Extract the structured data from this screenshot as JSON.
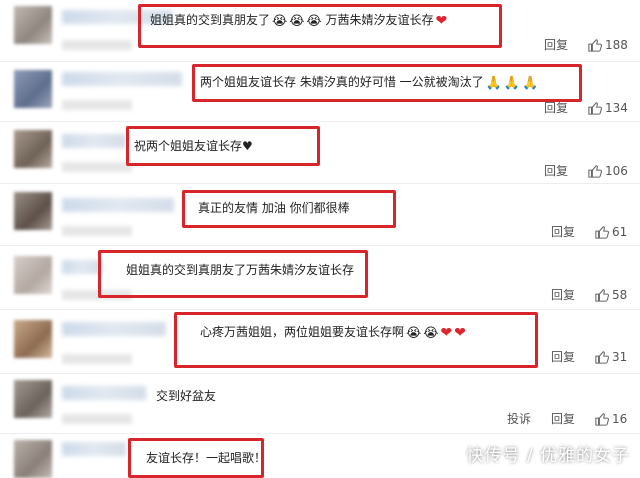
{
  "comments": [
    {
      "text": "姐姐真的交到真朋友了",
      "emoji_after_text": [
        "crying-face",
        "crying-face",
        "crying-face"
      ],
      "text2": "万茜朱婧汐友谊长存",
      "hearts": 1,
      "reply_label": "回复",
      "likes": "188"
    },
    {
      "text": "两个姐姐友谊长存 朱婧汐真的好可惜 一公就被淘汰了",
      "emoji_after_text": [
        "pray-icon",
        "pray-icon",
        "pray-icon"
      ],
      "reply_label": "回复",
      "likes": "134"
    },
    {
      "text": "祝两个姐姐友谊长存♥",
      "reply_label": "回复",
      "likes": "106"
    },
    {
      "text": "真正的友情 加油 你们都很棒",
      "reply_label": "回复",
      "likes": "61"
    },
    {
      "text": "姐姐真的交到真朋友了万茜朱婧汐友谊长存",
      "reply_label": "回复",
      "likes": "58"
    },
    {
      "text": "心疼万茜姐姐，两位姐姐要友谊长存啊",
      "emoji_after_text": [
        "crying-face",
        "crying-face"
      ],
      "hearts": 2,
      "reply_label": "回复",
      "likes": "31"
    },
    {
      "text": "交到好盆友",
      "report_label": "投诉",
      "reply_label": "回复",
      "likes": "16"
    },
    {
      "text": "友谊长存！一起唱歌！"
    }
  ],
  "watermark": "快传号 / 优雅的女子",
  "colors": {
    "highlight": "#d8252b",
    "heart": "#e0242e"
  }
}
